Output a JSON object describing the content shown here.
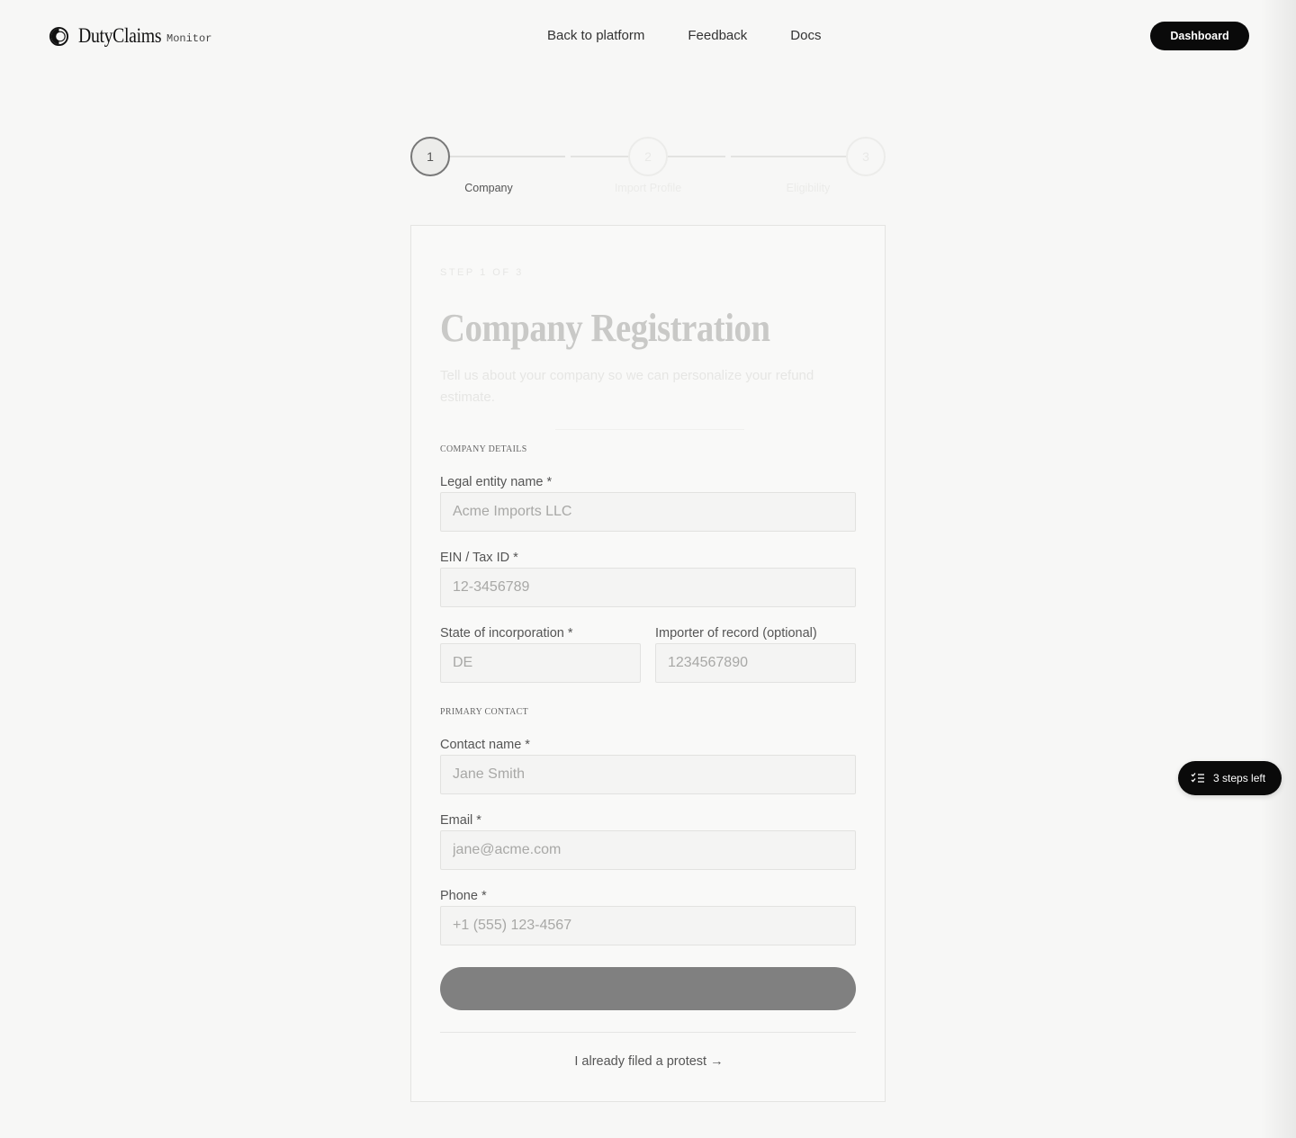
{
  "header": {
    "brand_name": "DutyClaims",
    "brand_tag": "Monitor",
    "nav": [
      "Back to platform",
      "Feedback",
      "Docs"
    ],
    "dashboard_label": "Dashboard"
  },
  "stepper": {
    "steps": [
      {
        "number": "1",
        "label": "Company"
      },
      {
        "number": "2",
        "label": "Import Profile"
      },
      {
        "number": "3",
        "label": "Eligibility"
      }
    ],
    "current_step": 1
  },
  "form": {
    "eyebrow": "STEP 1 OF 3",
    "title": "Company Registration",
    "subtitle": "Tell us about your company so we can personalize your refund estimate.",
    "section_company": "COMPANY DETAILS",
    "legal_name": {
      "label": "Legal entity name *",
      "placeholder": "Acme Imports LLC"
    },
    "ein": {
      "label": "EIN / Tax ID *",
      "placeholder": "12-3456789"
    },
    "state": {
      "label": "State of incorporation *",
      "placeholder": "DE"
    },
    "importer": {
      "label": "Importer of record (optional)",
      "placeholder": "1234567890"
    },
    "section_contact": "PRIMARY CONTACT",
    "contact_name": {
      "label": "Contact name *",
      "placeholder": "Jane Smith"
    },
    "email": {
      "label": "Email *",
      "placeholder": "jane@acme.com"
    },
    "phone": {
      "label": "Phone *",
      "placeholder": "+1 (555) 123-4567"
    },
    "submit_label": "",
    "filed_link": "I already filed a protest →"
  },
  "floating": {
    "steps_left": "3 steps left",
    "icon": "checklist-icon"
  },
  "colors": {
    "background": "#f7f7f6",
    "primary": "#0a0a0a",
    "submit_disabled": "#808080"
  }
}
